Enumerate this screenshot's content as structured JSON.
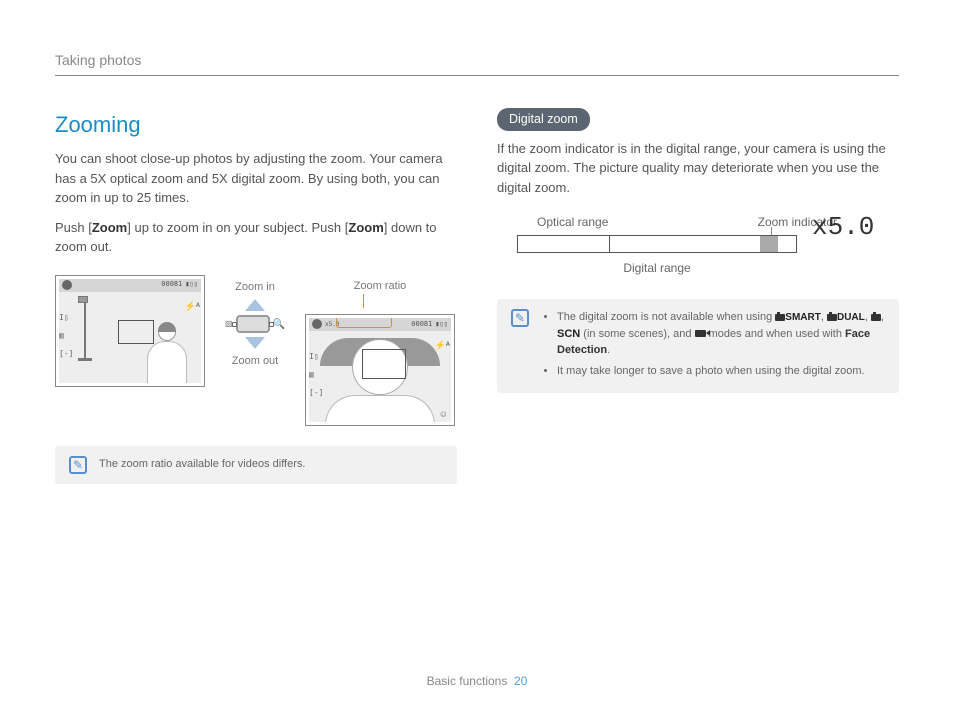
{
  "breadcrumb": "Taking photos",
  "left": {
    "heading": "Zooming",
    "p1_a": "You can shoot close-up photos by adjusting the zoom. Your camera has a 5X optical zoom and 5X digital zoom. By using both, you can zoom in up to 25 times.",
    "p2_a": "Push [",
    "p2_b": "Zoom",
    "p2_c": "] up to zoom in on your subject. Push [",
    "p2_d": "Zoom",
    "p2_e": "] down to zoom out.",
    "labels": {
      "zoom_ratio": "Zoom ratio",
      "zoom_in": "Zoom in",
      "zoom_out": "Zoom out"
    },
    "screen_status": {
      "counter": "00081",
      "batt": "▮▯▯",
      "zoom_bar_val": "x5.0"
    },
    "note": "The zoom ratio available for videos differs."
  },
  "right": {
    "pill": "Digital zoom",
    "p1": "If the zoom indicator is in the digital range, your camera is using the digital zoom. The picture quality may deteriorate when you use the digital zoom.",
    "bar": {
      "optical": "Optical range",
      "indicator": "Zoom indicator",
      "digital": "Digital range",
      "value": "x5.0"
    },
    "note1_a": "The digital zoom is not available when using ",
    "note1_smart": "SMART",
    "note1_dual": "DUAL",
    "note1_b": ", ",
    "note1_c": ", ",
    "note1_scn": "SCN",
    "note1_d": " (in some scenes), and ",
    "note1_e": " modes and when used with ",
    "note1_face": "Face Detection",
    "note1_f": ".",
    "note2": "It may take longer to save a photo when using the digital zoom."
  },
  "footer": {
    "section": "Basic functions",
    "page": "20"
  }
}
